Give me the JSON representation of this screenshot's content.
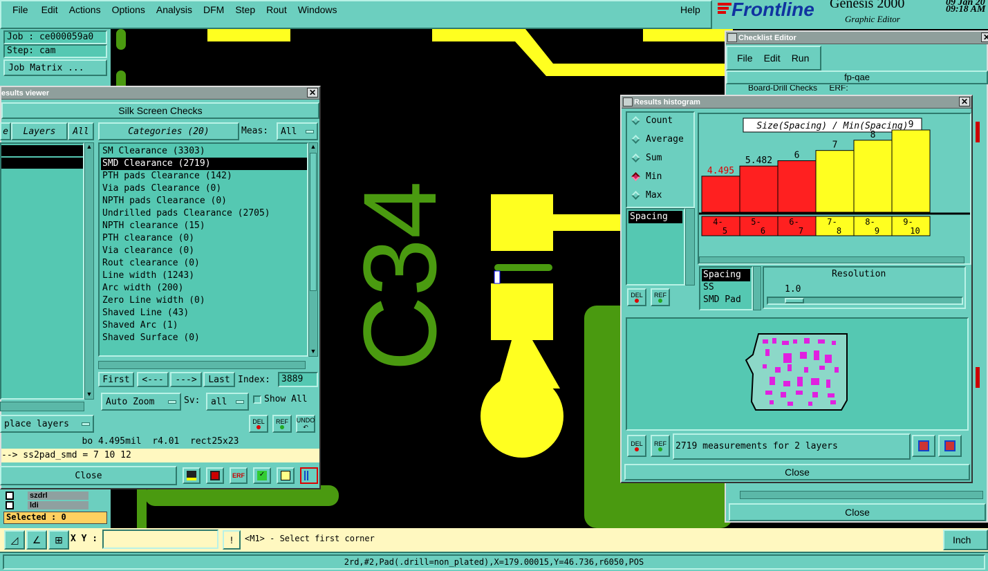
{
  "menu": {
    "items": [
      "File",
      "Edit",
      "Actions",
      "Options",
      "Analysis",
      "DFM",
      "Step",
      "Rout",
      "Windows"
    ],
    "help": "Help"
  },
  "brand": {
    "logo": "Frontline",
    "product": "Genesis 2000",
    "subtitle": "Graphic Editor",
    "date": "09 Jan 20",
    "time": "09:18 AM"
  },
  "job_panel": {
    "job": "Job : ce000059a0",
    "step": "Step: cam",
    "matrix": "Job Matrix ...",
    "layers": [
      "szdrl",
      "ldi"
    ],
    "selected": "Selected : 0"
  },
  "results_viewer": {
    "title": "esults viewer",
    "heading": "Silk Screen Checks",
    "layers_label": "Layers",
    "layers_all": "All",
    "tab_left": "e",
    "categories_label": "Categories (20)",
    "meas_label": "Meas:",
    "meas_value": "All",
    "categories": [
      "SM Clearance (3303)",
      "SMD Clearance (2719)",
      "PTH pads Clearance (142)",
      "Via pads Clearance (0)",
      "NPTH pads Clearance (0)",
      "Undrilled pads Clearance (2705)",
      "NPTH clearance (15)",
      "PTH clearance (0)",
      "Via clearance (0)",
      "Rout clearance (0)",
      "Line width (1243)",
      "Arc width (200)",
      "Zero Line width (0)",
      "Shaved Line (43)",
      "Shaved Arc (1)",
      "Shaved Surface (0)"
    ],
    "selected_index": 1,
    "nav": {
      "first": "First",
      "prev": "<---",
      "next": "--->",
      "last": "Last",
      "index_label": "Index:",
      "index_value": "3889"
    },
    "auto_zoom": "Auto Zoom",
    "sv_label": "Sv:",
    "sv_value": "all",
    "show_all": "Show All",
    "replace_layers": "place layers",
    "del": "DEL",
    "ref": "REF",
    "undo": "UNDO",
    "info": "bo 4.495mil  r4.01  rect25x23",
    "result": "--> ss2pad_smd = 7 10 12",
    "close": "Close"
  },
  "checklist": {
    "title": "Checklist Editor",
    "menu": [
      "File",
      "Edit",
      "Run"
    ],
    "name": "fp-qae",
    "row": "Board-Drill Checks",
    "row_status": "ERF:",
    "close": "Close"
  },
  "histogram": {
    "title": "Results histogram",
    "modes": [
      "Count",
      "Average",
      "Sum",
      "Min",
      "Max"
    ],
    "selected_mode": "Min",
    "list_left": [
      "Spacing"
    ],
    "chart_title": "Size(Spacing) / Min(Spacing)",
    "measures": [
      "Spacing",
      "SS",
      "SMD Pad"
    ],
    "resolution_label": "Resolution",
    "resolution_value": "1.0",
    "summary": "2719 measurements for 2 layers",
    "del": "DEL",
    "ref": "REF",
    "close": "Close",
    "bar_red": "#ff2020",
    "bar_yellow": "#ffff20"
  },
  "chart_data": {
    "type": "bar",
    "title": "Size(Spacing) / Min(Spacing)",
    "categories": [
      "4-5",
      "5-6",
      "6-7",
      "7-8",
      "8-9",
      "9-10"
    ],
    "category_labels": [
      [
        "4-",
        "5"
      ],
      [
        "5-",
        "6"
      ],
      [
        "6-",
        "7"
      ],
      [
        "7-",
        "8"
      ],
      [
        "8-",
        "9"
      ],
      [
        "9-",
        "10"
      ]
    ],
    "values": [
      4.495,
      5.482,
      6,
      7,
      8,
      9
    ],
    "value_labels": [
      "4.495",
      "5.482",
      "6",
      "7",
      "8",
      "9"
    ],
    "colors": [
      "red",
      "red",
      "red",
      "yellow",
      "yellow",
      "yellow"
    ],
    "ylim": [
      0,
      10
    ]
  },
  "bottom": {
    "xy_label": "X Y :",
    "xy_value": "",
    "prompt": "<M1> - Select first corner",
    "units": "Inch",
    "status": "2rd,#2,Pad(.drill=non_plated),X=179.00015,Y=46.736,r6050,POS"
  },
  "canvas": {
    "silk_text": "C34"
  }
}
